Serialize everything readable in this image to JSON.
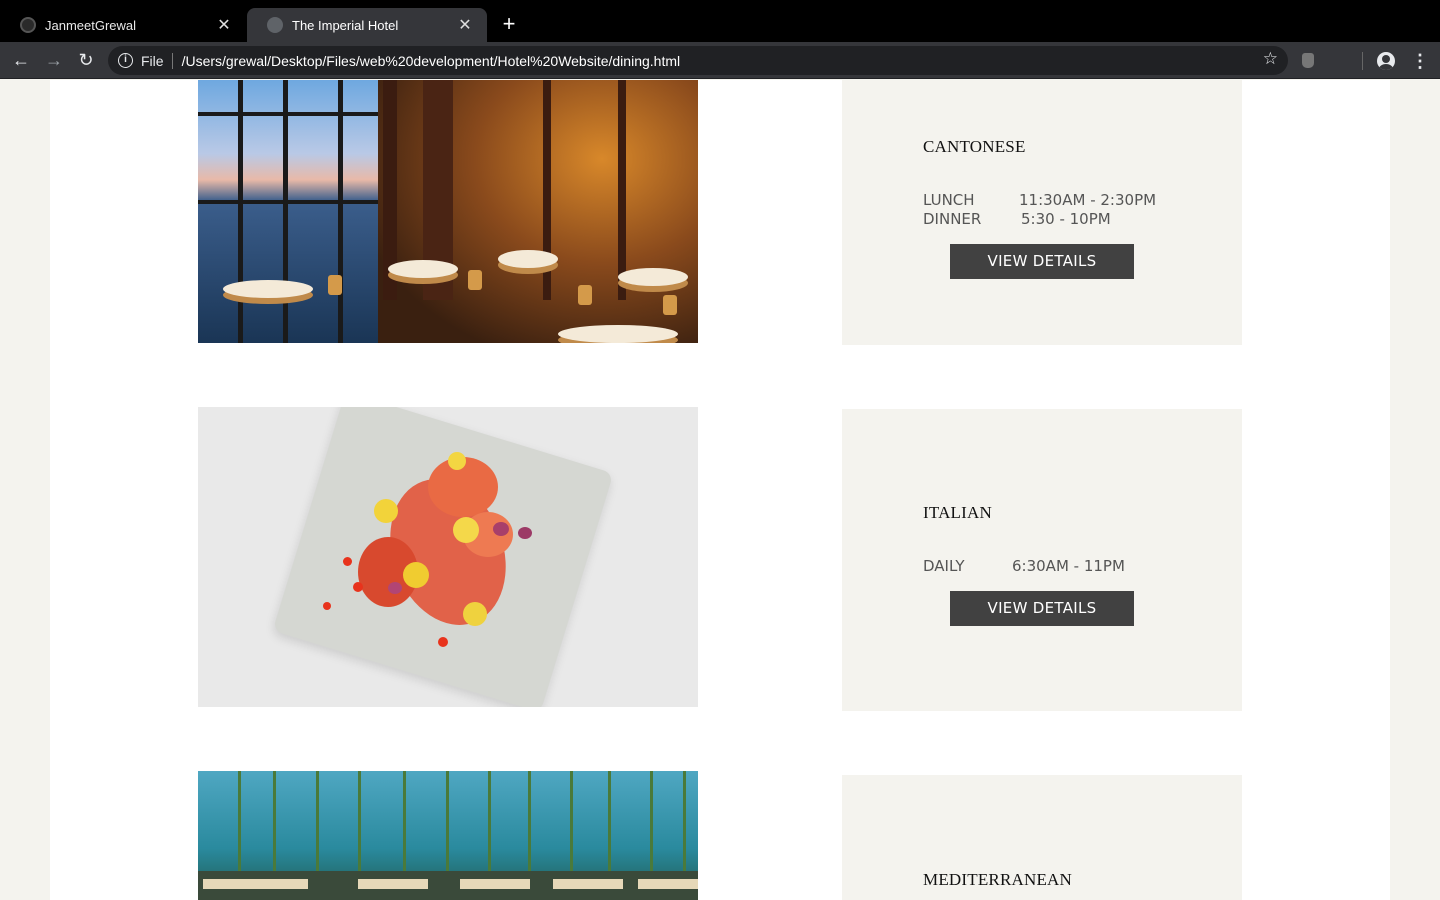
{
  "browser": {
    "tabs": [
      {
        "title": "JanmeetGrewal",
        "active": false
      },
      {
        "title": "The Imperial Hotel",
        "active": true
      }
    ],
    "address": {
      "scheme": "File",
      "url": "/Users/grewal/Desktop/Files/web%20development/Hotel%20Website/dining.html"
    },
    "icons": {
      "back": "arrow-left-icon",
      "forward": "arrow-right-icon",
      "reload": "reload-icon",
      "info": "info-icon",
      "bookmark": "star-icon",
      "extension": "extension-icon",
      "profile": "profile-icon",
      "menu": "kebab-menu-icon",
      "close_tab": "close-icon",
      "new_tab": "plus-icon"
    }
  },
  "restaurants": [
    {
      "name": "CANTONESE",
      "hours": [
        {
          "label": "LUNCH",
          "time": "11:30AM - 2:30PM"
        },
        {
          "label": "DINNER",
          "time": "5:30 - 10PM"
        }
      ],
      "button": "VIEW DETAILS"
    },
    {
      "name": "ITALIAN",
      "hours": [
        {
          "label": "DAILY",
          "time": "6:30AM - 11PM"
        }
      ],
      "button": "VIEW DETAILS"
    },
    {
      "name": "MEDITERRANEAN"
    }
  ],
  "colors": {
    "page_background": "#f4f3ee",
    "card_background": "#f4f3ee",
    "button_background": "#414141",
    "chrome_dark": "#35363a"
  }
}
